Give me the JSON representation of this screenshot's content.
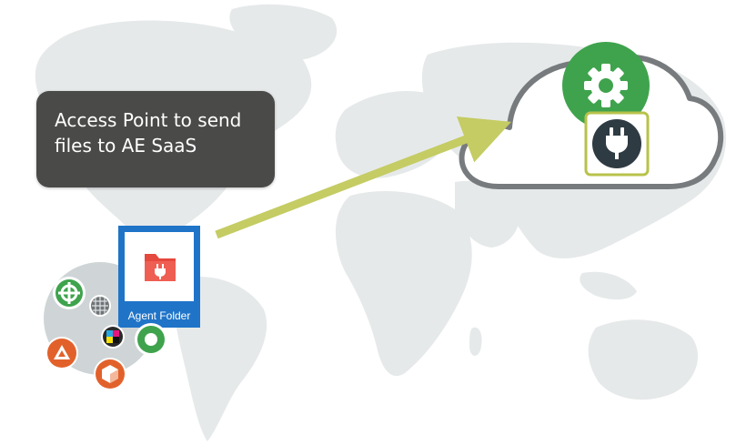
{
  "callout": {
    "line1": "Access Point to send",
    "line2": "files to AE SaaS"
  },
  "agent_folder": {
    "label": "Agent Folder",
    "icon": "plug-folder-icon",
    "tile_color": "#1f74c8",
    "folder_color": "#e5483d"
  },
  "cloud": {
    "icons": [
      "gear-icon",
      "plug-icon"
    ],
    "gear_color": "#3fa34d",
    "plug_bg_color": "#2f3b43",
    "plug_border_color": "#b8c24a"
  },
  "arrow": {
    "color": "#c4cc63"
  },
  "agent_badges": [
    "green-crosshair-icon",
    "gray-mesh-icon",
    "cmyk-icon",
    "green-ring-icon",
    "orange-triangle-icon",
    "orange-cube-icon"
  ],
  "colors": {
    "map": "#e6e9ea",
    "callout_bg": "#4a4a48",
    "orange": "#e2612b",
    "green": "#3fa34d"
  }
}
